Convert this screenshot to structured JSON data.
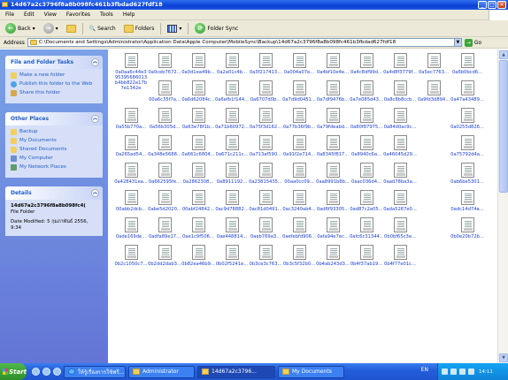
{
  "window": {
    "title": "14d67a2c3796f8a8b098fc461b3fbdad627fdf18",
    "controls": [
      "_",
      "□",
      "✕"
    ]
  },
  "menu": [
    "File",
    "Edit",
    "View",
    "Favorites",
    "Tools",
    "Help"
  ],
  "toolbar": {
    "back": "Back",
    "search": "Search",
    "folders": "Folders",
    "folder_sync": "Folder Sync"
  },
  "address": {
    "label": "Address",
    "path": "C:\\Documents and Settings\\Administrator\\Application Data\\Apple Computer\\MobileSync\\Backup\\14d67a2c3796f8a8b098fc461b3fbdad627fdf18",
    "go": "Go"
  },
  "left_pane": {
    "tasks": {
      "title": "File and Folder Tasks",
      "items": [
        "Make a new folder",
        "Publish this folder to the Web",
        "Share this folder"
      ]
    },
    "places": {
      "title": "Other Places",
      "items": [
        "Backup",
        "My Documents",
        "Shared Documents",
        "My Computer",
        "My Network Places"
      ]
    },
    "details": {
      "title": "Details",
      "name": "14d67a2c3796f8a8b098fc4(",
      "type": "File Folder",
      "modified": "Date Modified: 5 กุมภาพันธ์ 2556, 9:34"
    }
  },
  "files": [
    "0a0aa6c44e395395686013b4bb822e17b7e1342e",
    "0a0ceb7672...",
    "0a0d1ea49b...",
    "0a2a01c4b...",
    "0a3f217413...",
    "0a004a07e...",
    "0a4bf10e4e...",
    "0a4c8df99d...",
    "0a4d8f3779f...",
    "0a5ec7763...",
    "0a6b0bcd6...",
    "00a6c35f7a...",
    "0a6d62084c...",
    "0a6efb1f144...",
    "0a6707d0b...",
    "0a7d9d0451...",
    "0a7df9476b...",
    "0a7e085d43...",
    "0a8c8b8ccb...",
    "0a9fd3d894...",
    "0a47a43489...",
    "0a55b770a...",
    "0a56b305d...",
    "0a63e78f1b...",
    "0a71b60972...",
    "0a75f3d162...",
    "0a77b36f9b...",
    "0a79fdeabd...",
    "0a80f87975...",
    "0a84d0ac9c...",
    "",
    "0a0255d826...",
    "0a265ad54...",
    "0a348e5688...",
    "0a661c6804...",
    "0a671c211c...",
    "0a713af590...",
    "0a91f2e714...",
    "0a8345f817...",
    "0a8940c6a...",
    "0a46045d29...",
    "",
    "0a75792d4a...",
    "0a428431ea...",
    "0a662595fe...",
    "0a2862308...",
    "0a8911192...",
    "0a23815435...",
    "00aa0cc09...",
    "0aa8991b8b...",
    "0aac036d4...",
    "0aad78ba3a...",
    "",
    "0ab6be5301...",
    "00abb2dcb...",
    "0abe5d2020...",
    "00abf24842...",
    "0ac9d78882...",
    "0ac81d0491...",
    "0ac3240ab4...",
    "0ad6f93305...",
    "0ad87c2a05...",
    "0ada5267e0...",
    "",
    "0adc14d74a...",
    "0ade169de...",
    "0adfa89e17...",
    "0ae1c9f506...",
    "0ae448814...",
    "0aeb769a3...",
    "0aefebfd906...",
    "0afa94e7ec...",
    "0afc6c31344...",
    "0b0bf65c3e...",
    "",
    "0b0e20b72b...",
    "0b2c1050c7...",
    "0b2dd2dab3...",
    "0b82ea46b9...",
    "0b02f5241e...",
    "0b3ce3c763...",
    "0b3c5f32b0...",
    "0b4ab243d3...",
    "0b4f37ab19...",
    "0b4f77e01c...",
    ""
  ],
  "taskbar": {
    "start": "Start",
    "tasks": [
      "ให้รู้เรื่องการใช้ฟรี...",
      "Administrator",
      "14d67a2c3796...",
      "My Documents"
    ],
    "lang": "EN",
    "time": "14:11"
  },
  "colors": {
    "titlebar": "#0a3fd4",
    "left_pane": "#6375d6",
    "link": "#1a3ed6",
    "taskbar": "#245edb"
  }
}
